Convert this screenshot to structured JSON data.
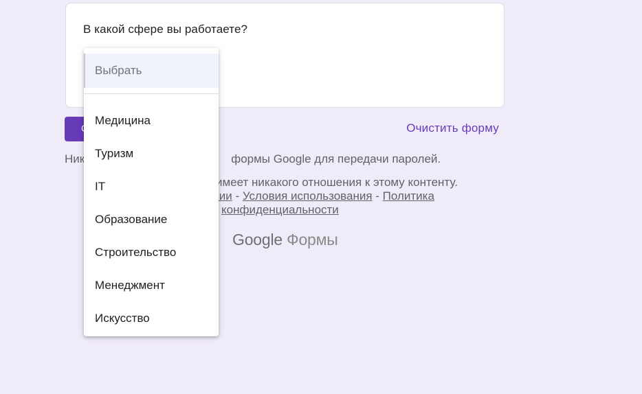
{
  "question": {
    "title": "В какой сфере вы работаете?"
  },
  "dropdown": {
    "selected_placeholder": "Выбрать",
    "options": [
      "Медицина",
      "Туризм",
      "IT",
      "Образование",
      "Строительство",
      "Менеджмент",
      "Искусство"
    ]
  },
  "actions": {
    "submit_label": "Отправить",
    "clear_label": "Очистить форму"
  },
  "footer": {
    "password_warning_visible_start": "Ник",
    "password_warning_visible_end": "формы Google для передачи паролей.",
    "disclaimer_line1": "имеет никакого отношения к этому контенту.",
    "disclaimer_link_partial": "лении",
    "separator": " - ",
    "terms_link": "Условия использования",
    "privacy_link_part1": "Политика",
    "privacy_link_part2": "конфиденциальности",
    "logo_google": "Google",
    "logo_forms": "Формы"
  },
  "colors": {
    "background": "#f0ebf8",
    "accent": "#673ab7",
    "selected_option_bg": "#eef3fc"
  }
}
